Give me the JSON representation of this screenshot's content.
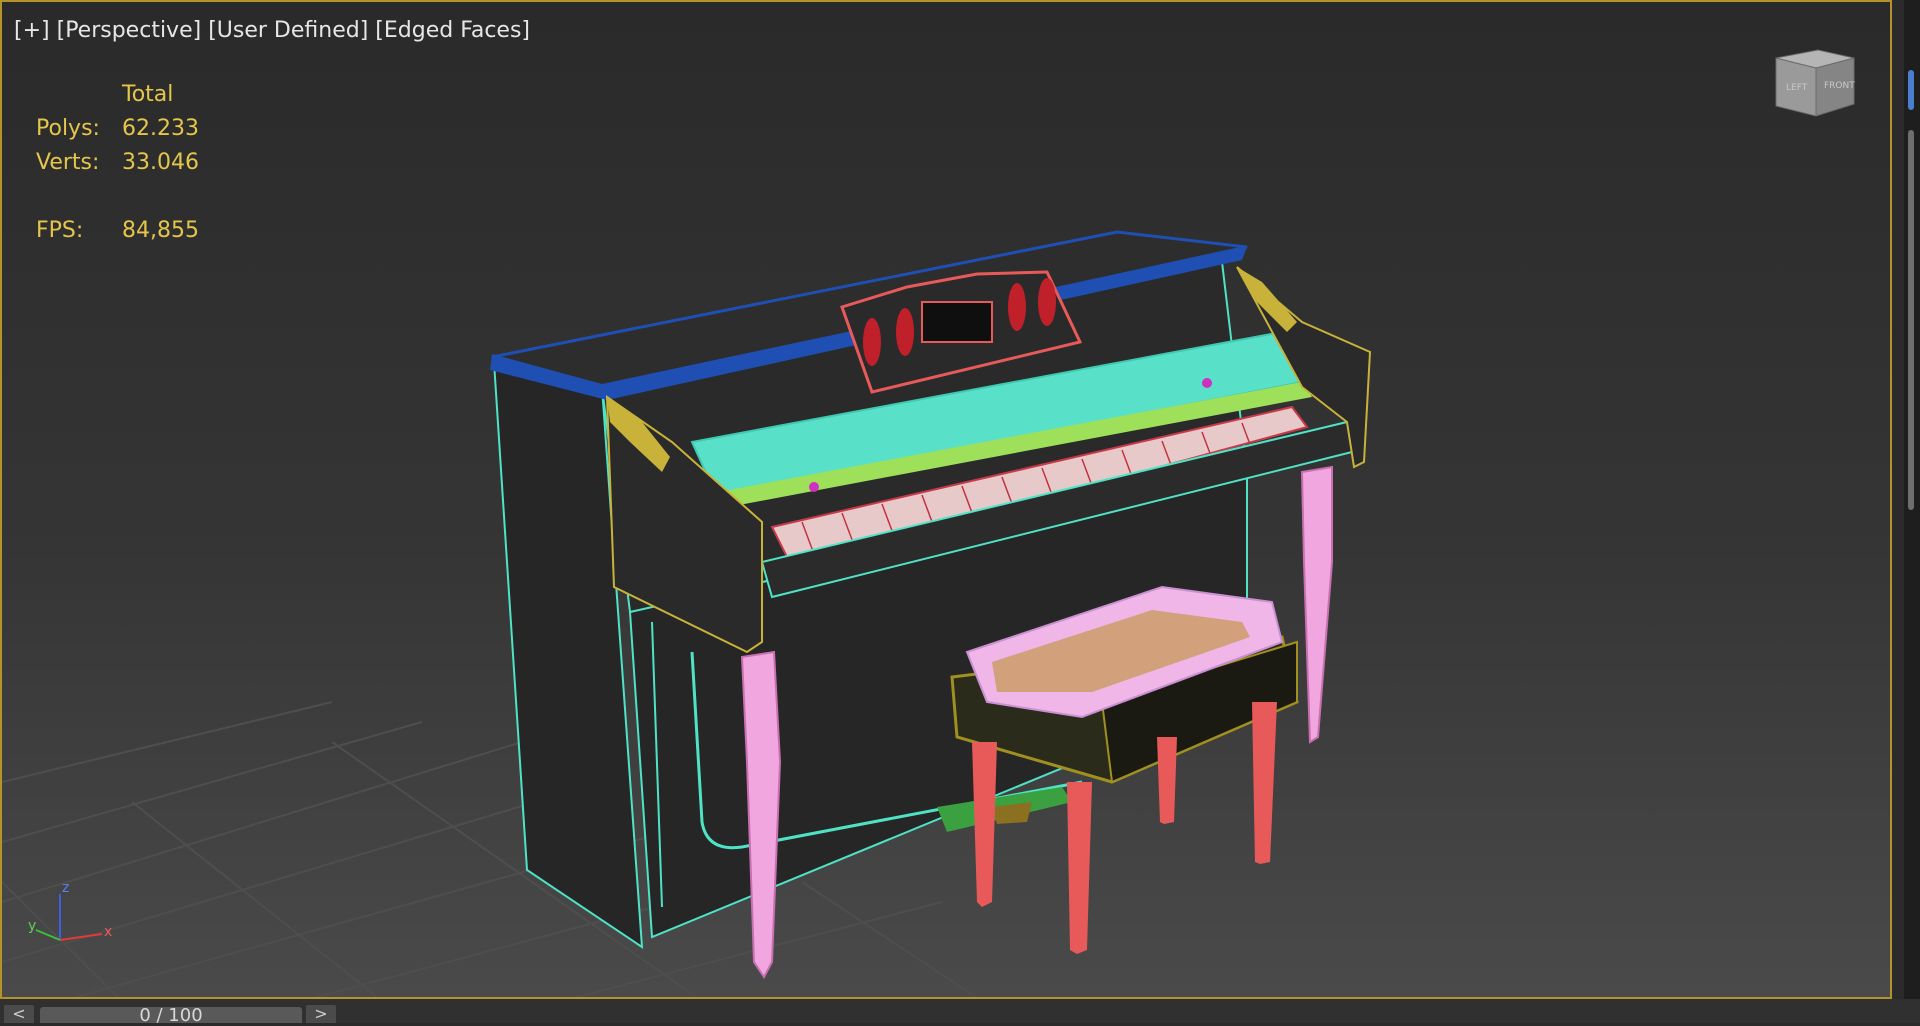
{
  "viewport": {
    "label_plus": "[+]",
    "label_view": "[Perspective]",
    "label_shading": "[User Defined]",
    "label_edges": "[Edged Faces]",
    "active_border_color": "#b3932a"
  },
  "stats": {
    "header": "Total",
    "polys_label": "Polys:",
    "polys_value": "62.233",
    "verts_label": "Verts:",
    "verts_value": "33.046",
    "fps_label": "FPS:",
    "fps_value": "84,855",
    "text_color": "#e5c64a"
  },
  "viewcube": {
    "icon": "viewcube-icon",
    "faces": [
      "LEFT",
      "FRONT"
    ]
  },
  "axis": {
    "z": "z",
    "y": "y",
    "x": "x"
  },
  "timeline": {
    "prev_label": "<",
    "next_label": ">",
    "frame_display": "0 / 100"
  },
  "scene": {
    "piano_wire_color": "#4fe3c6",
    "piano_top_color": "#1f4fb3",
    "trim_color": "#c9b23a",
    "leg_color": "#f2a6e0",
    "bench_leg_color": "#e85a5a",
    "cushion_color": "#f0b6e8"
  }
}
